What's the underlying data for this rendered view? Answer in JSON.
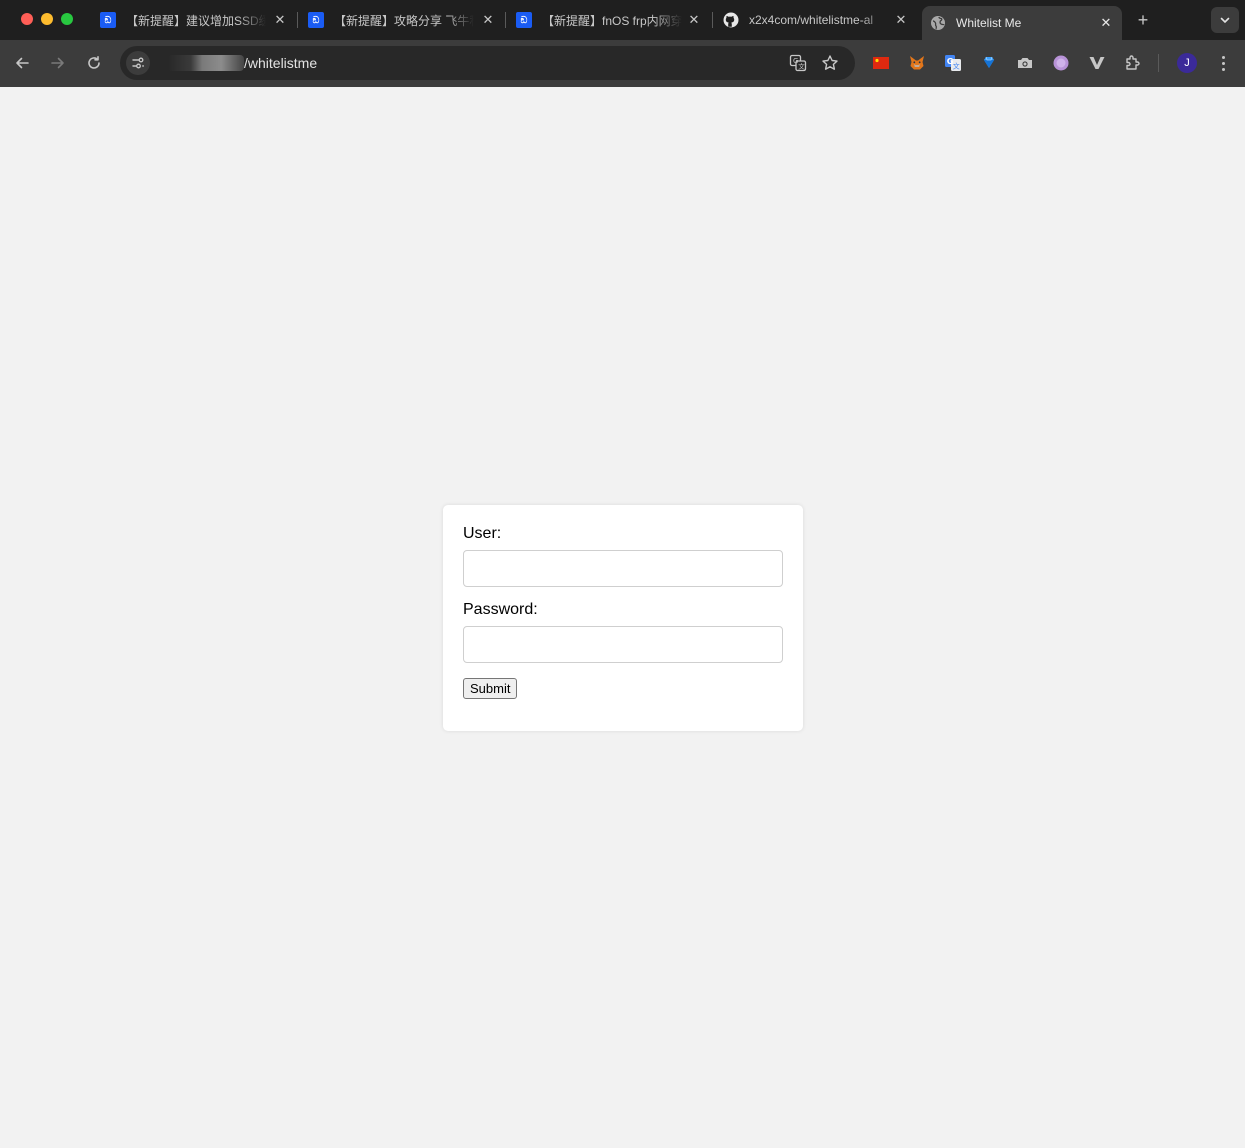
{
  "browser": {
    "tabs": [
      {
        "title": "【新提醒】建议增加SSD缓存",
        "favicon": "feiniu-icon"
      },
      {
        "title": "【新提醒】攻略分享 飞牛私有云",
        "favicon": "feiniu-icon"
      },
      {
        "title": "【新提醒】fnOS frp内网穿透",
        "favicon": "feiniu-icon"
      },
      {
        "title": "x2x4com/whitelistme-al",
        "favicon": "github-icon"
      },
      {
        "title": "Whitelist Me",
        "favicon": "globe-icon",
        "active": true
      }
    ],
    "new_tab_label": "+",
    "url_path": "/whitelistme",
    "profile_initial": "J",
    "colors": {
      "chrome_bg": "#1f1f1f",
      "toolbar_bg": "#3c3c3c",
      "omnibox_bg": "#282828",
      "page_bg": "#f2f2f2"
    }
  },
  "form": {
    "user_label": "User:",
    "user_value": "",
    "password_label": "Password:",
    "password_value": "",
    "submit_label": "Submit"
  }
}
